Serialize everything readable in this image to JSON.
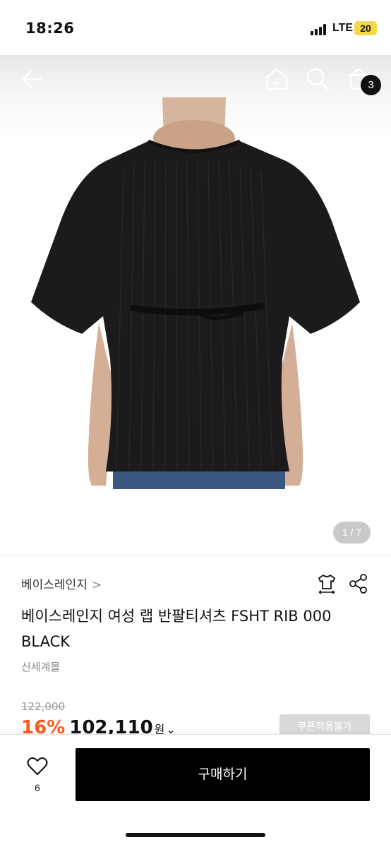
{
  "status_bar": {
    "time": "18:26",
    "network": "LTE",
    "battery": "20"
  },
  "top_nav": {
    "back_icon": "arrow-left-icon",
    "home_icon": "home-icon",
    "search_icon": "search-icon",
    "cart_icon": "shopping-bag-icon",
    "cart_count": "3"
  },
  "gallery": {
    "pager": "1 / 7"
  },
  "product": {
    "brand": "베이스레인지",
    "brand_chevron": ">",
    "title": "베이스레인지 여성 랩 반팔티셔츠 FSHT RIB 000 BLACK",
    "seller": "신세계몰",
    "original_price": "122,000",
    "discount": "16%",
    "price": "102,110",
    "currency": "원",
    "currency_chevron": "⌄",
    "coupon_label": "쿠폰적용불가",
    "size_icon": "tshirt-size-icon",
    "share_icon": "share-icon"
  },
  "bottom_bar": {
    "like_icon": "heart-icon",
    "like_count": "6",
    "buy_label": "구매하기"
  },
  "colors": {
    "accent_discount": "#ff5a1f",
    "buy_button": "#000000",
    "battery": "#f4d84a"
  }
}
